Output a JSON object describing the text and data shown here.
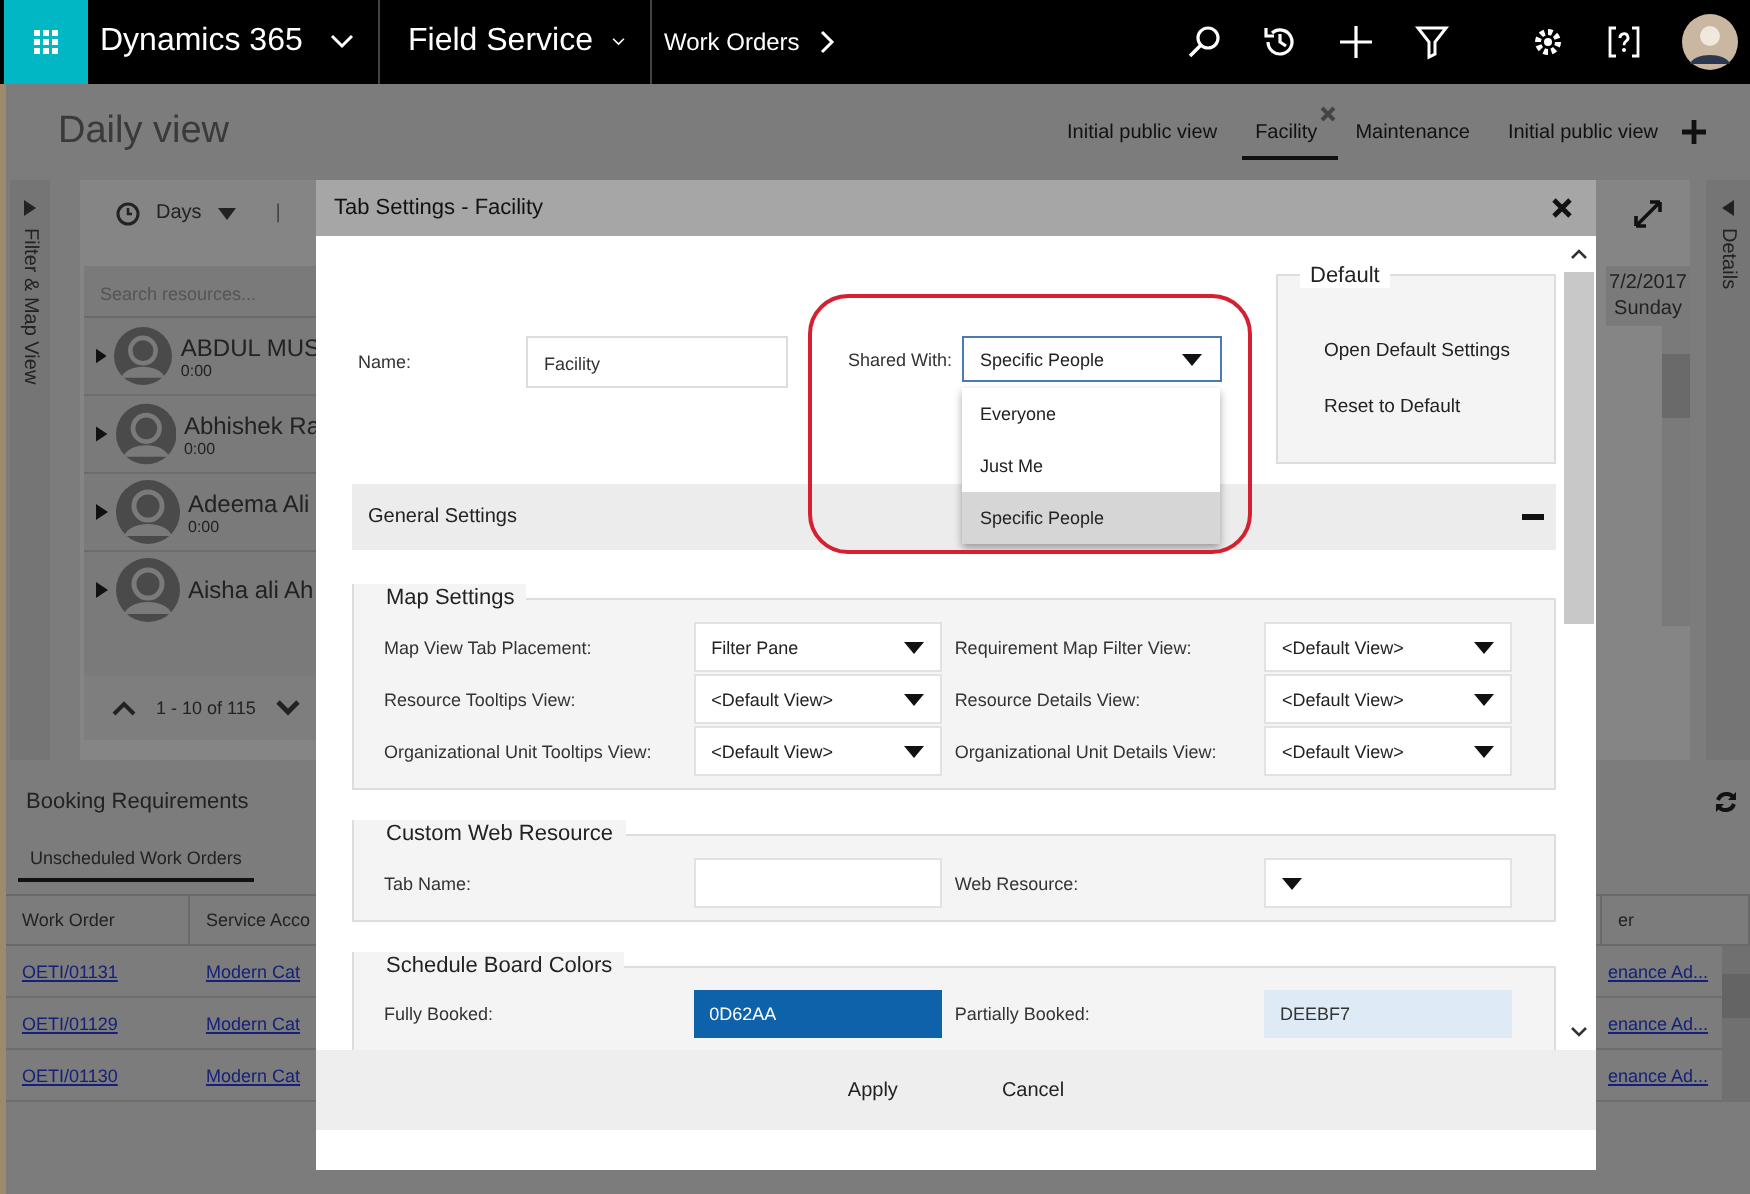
{
  "app_bar": {
    "app_name": "Dynamics 365",
    "module": "Field Service",
    "breadcrumb": "Work Orders"
  },
  "board": {
    "title": "Daily view",
    "view_tabs": [
      {
        "label": "Initial public view",
        "selected": false
      },
      {
        "label": "Facility",
        "selected": true
      },
      {
        "label": "Maintenance",
        "selected": false
      },
      {
        "label": "Initial public view",
        "selected": false
      }
    ],
    "filter_pane_label": "Filter & Map View",
    "details_pane_label": "Details",
    "time_scale": "Days",
    "separator": "|",
    "search_placeholder": "Search resources...",
    "resources": [
      {
        "name": "ABDUL MUS",
        "hours": "0:00"
      },
      {
        "name": "Abhishek Ra",
        "hours": "0:00"
      },
      {
        "name": "Adeema Ali",
        "hours": "0:00"
      },
      {
        "name": "Aisha ali Ah"
      }
    ],
    "pager": "1 - 10 of 115",
    "date": "7/2/2017",
    "weekday": "Sunday"
  },
  "requirements": {
    "title": "Booking Requirements",
    "tabs": [
      {
        "label": "Unscheduled Work Orders",
        "selected": true
      }
    ],
    "columns": [
      "Work Order",
      "Service Acco",
      "er"
    ],
    "rows": [
      {
        "work_order": "OETI/01131",
        "service_account": "Modern Cat",
        "column_3": "enance Ad..."
      },
      {
        "work_order": "OETI/01129",
        "service_account": "Modern Cat",
        "column_3": "enance Ad..."
      },
      {
        "work_order": "OETI/01130",
        "service_account": "Modern Cat",
        "column_3": "enance Ad..."
      }
    ]
  },
  "dialog": {
    "title": "Tab Settings - Facility",
    "name_label": "Name:",
    "name_value": "Facility",
    "shared_label": "Shared With:",
    "shared_value": "Specific People",
    "shared_options": [
      {
        "label": "Everyone",
        "selected": false
      },
      {
        "label": "Just Me",
        "selected": false
      },
      {
        "label": "Specific People",
        "selected": true
      }
    ],
    "default_box": {
      "title": "Default",
      "actions": [
        "Open Default Settings",
        "Reset to Default"
      ]
    },
    "general_settings": {
      "label": "General Settings",
      "expanded": true
    },
    "sections": [
      {
        "title": "Map Settings",
        "fields": [
          {
            "kind": "select",
            "label": "Map View Tab Placement:",
            "value": "Filter Pane"
          },
          {
            "kind": "select",
            "label": "Requirement Map Filter View:",
            "value": "<Default View>"
          },
          {
            "kind": "select",
            "label": "Resource Tooltips View:",
            "value": "<Default View>"
          },
          {
            "kind": "select",
            "label": "Resource Details View:",
            "value": "<Default View>"
          },
          {
            "kind": "select",
            "label": "Organizational Unit Tooltips View:",
            "value": "<Default View>"
          },
          {
            "kind": "select",
            "label": "Organizational Unit Details View:",
            "value": "<Default View>"
          }
        ]
      },
      {
        "title": "Custom Web Resource",
        "fields": [
          {
            "kind": "input",
            "label": "Tab Name:"
          },
          {
            "kind": "select",
            "label": "Web Resource:"
          }
        ]
      },
      {
        "title": "Schedule Board Colors",
        "fields": [
          {
            "kind": "color",
            "label": "Fully Booked:",
            "value": "0D62AA",
            "color": "#0d62aa"
          },
          {
            "kind": "color",
            "label": "Partially Booked:",
            "value": "DEEBF7",
            "color": "#deebf7"
          }
        ]
      }
    ],
    "buttons": [
      "Apply",
      "Cancel"
    ]
  }
}
